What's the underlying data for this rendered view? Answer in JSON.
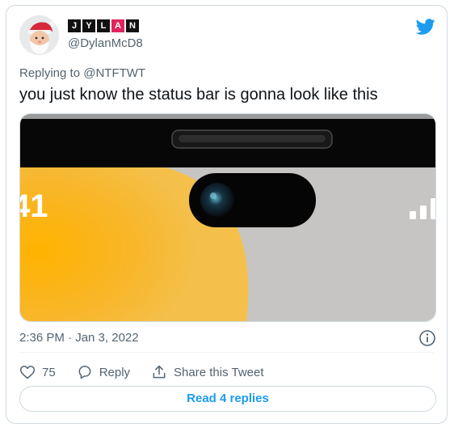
{
  "author": {
    "display_name_letters": [
      "J",
      "Y",
      "L",
      "A",
      "N"
    ],
    "highlight_letter_index": 3,
    "handle": "@DylanMcD8"
  },
  "reply": {
    "prefix": "Replying to",
    "handle": "@NTFTWT"
  },
  "tweet": {
    "text": "you just know the status bar is gonna look like this",
    "timestamp": "2:36 PM · Jan 3, 2022"
  },
  "media": {
    "time_fragment": "41"
  },
  "actions": {
    "likes_count": "75",
    "reply_label": "Reply",
    "share_label": "Share this Tweet"
  },
  "read_replies_label": "Read 4 replies",
  "colors": {
    "twitter_blue": "#1d9bf0",
    "secondary_text": "#536471",
    "highlight_letter": "#e0245e",
    "wallpaper_yellow": "#f6b21b",
    "wallpaper_gray": "#c6c5c3"
  },
  "icons": [
    "twitter-bird-icon",
    "info-icon",
    "heart-icon",
    "reply-icon",
    "share-icon"
  ]
}
